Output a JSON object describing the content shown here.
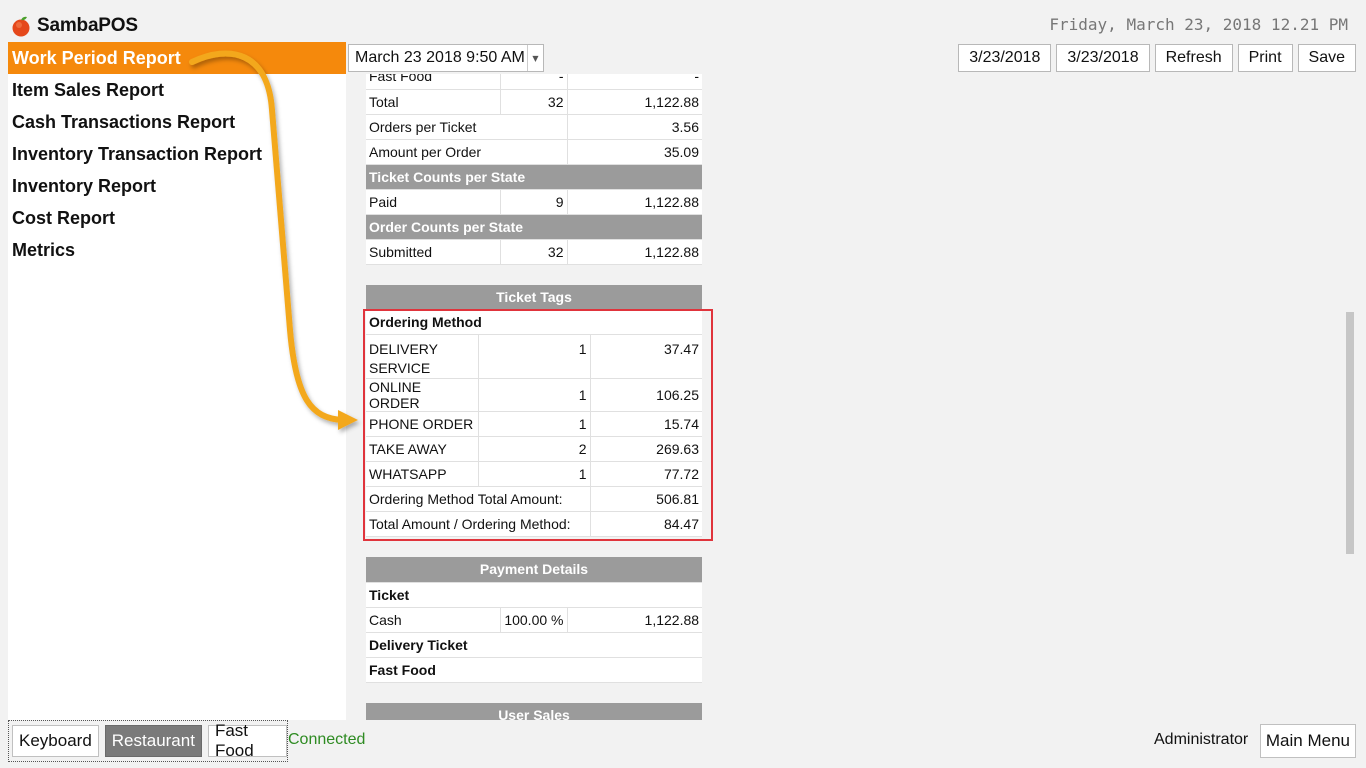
{
  "app": {
    "name": "SambaPOS",
    "clock": "Friday, March 23, 2018 12.21 PM"
  },
  "sidebar": {
    "items": [
      {
        "label": "Work Period Report"
      },
      {
        "label": "Item Sales Report"
      },
      {
        "label": "Cash Transactions Report"
      },
      {
        "label": "Inventory Transaction Report"
      },
      {
        "label": "Inventory Report"
      },
      {
        "label": "Cost Report"
      },
      {
        "label": "Metrics"
      }
    ]
  },
  "toolbar": {
    "period": "March 23 2018 9:50 AM",
    "start_date": "3/23/2018",
    "end_date": "3/23/2018",
    "refresh": "Refresh",
    "print": "Print",
    "save": "Save"
  },
  "report": {
    "summary_rows": [
      {
        "label": "Fast Food",
        "count": "-",
        "amount": "-"
      },
      {
        "label": "Total",
        "count": "32",
        "amount": "1,122.88"
      }
    ],
    "orders_per_ticket": {
      "label": "Orders per Ticket",
      "value": "3.56"
    },
    "amount_per_order": {
      "label": "Amount per Order",
      "value": "35.09"
    },
    "ticket_counts": {
      "title": "Ticket Counts per State",
      "rows": [
        {
          "label": "Paid",
          "count": "9",
          "amount": "1,122.88"
        }
      ]
    },
    "order_counts": {
      "title": "Order Counts per State",
      "rows": [
        {
          "label": "Submitted",
          "count": "32",
          "amount": "1,122.88"
        }
      ]
    },
    "ticket_tags": {
      "title": "Ticket Tags",
      "group": "Ordering Method",
      "rows": [
        {
          "label": "DELIVERY SERVICE",
          "count": "1",
          "amount": "37.47"
        },
        {
          "label": "ONLINE ORDER",
          "count": "1",
          "amount": "106.25"
        },
        {
          "label": "PHONE ORDER",
          "count": "1",
          "amount": "15.74"
        },
        {
          "label": "TAKE AWAY",
          "count": "2",
          "amount": "269.63"
        },
        {
          "label": "WHATSAPP",
          "count": "1",
          "amount": "77.72"
        }
      ],
      "total_label": "Ordering Method Total Amount:",
      "total_value": "506.81",
      "avg_label": "Total Amount / Ordering Method:",
      "avg_value": "84.47"
    },
    "payment_details": {
      "title": "Payment Details",
      "ticket_label": "Ticket",
      "cash": {
        "label": "Cash",
        "percent": "100.00 %",
        "amount": "1,122.88"
      },
      "delivery_ticket": "Delivery Ticket",
      "fast_food": "Fast Food"
    },
    "user_sales": {
      "title": "User Sales"
    }
  },
  "bottom": {
    "buttons": [
      {
        "label": "Keyboard"
      },
      {
        "label": "Restaurant"
      },
      {
        "label": "Fast Food"
      }
    ],
    "status": "Connected",
    "user": "Administrator",
    "main_menu": "Main Menu"
  },
  "colors": {
    "accent": "#f5890c",
    "highlight": "#e0343c",
    "arrow": "#f3a81f",
    "status": "#2e8b22",
    "header": "#9b9b9b"
  }
}
